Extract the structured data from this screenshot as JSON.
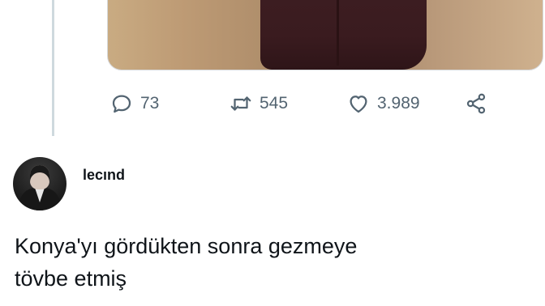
{
  "previous_tweet": {
    "counts": {
      "replies": "73",
      "retweets": "545",
      "likes": "3.989"
    },
    "icons": [
      "reply-icon",
      "retweet-icon",
      "like-icon",
      "share-icon"
    ]
  },
  "quoted_tweet": {
    "username": "lecınd",
    "text": "Konya'yı gördükten sonra gezmeye\ntövbe etmiş"
  },
  "colors": {
    "action_gray": "#536471",
    "text": "#0f1419",
    "thread_line": "#cfd9de"
  }
}
